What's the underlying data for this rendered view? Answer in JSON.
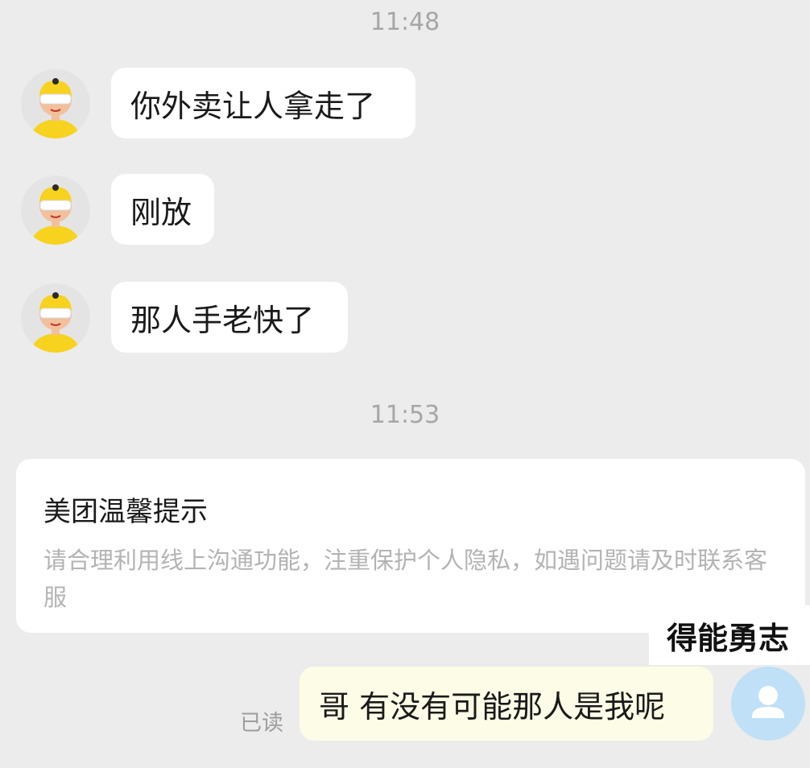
{
  "timestamps": [
    "11:48",
    "11:53"
  ],
  "incoming_messages": [
    {
      "sender_avatar": "courier-avatar-icon",
      "text": "你外卖让人拿走了"
    },
    {
      "sender_avatar": "courier-avatar-icon",
      "text": "刚放"
    },
    {
      "sender_avatar": "courier-avatar-icon",
      "text": "那人手老快了"
    }
  ],
  "system_notice": {
    "title": "美团温馨提示",
    "body": "请合理利用线上沟通功能，注重保护个人隐私，如遇问题请及时联系客服"
  },
  "outgoing_message": {
    "text": "哥 有没有可能那人是我呢",
    "status": "已读",
    "avatar": "user-avatar-icon"
  },
  "watermark": "得能勇志",
  "colors": {
    "background": "#ececec",
    "incoming_bubble": "#ffffff",
    "outgoing_bubble": "#fdfce6",
    "timestamp_text": "#a6a6a6",
    "notice_body_text": "#b3b3b3",
    "courier_helmet": "#f7d21e",
    "user_avatar": "#bfe0f6"
  }
}
